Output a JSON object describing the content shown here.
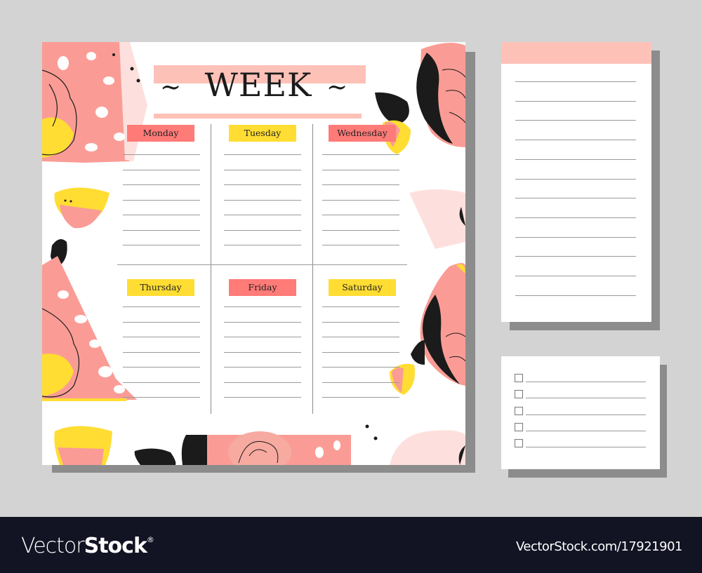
{
  "planner": {
    "title": "WEEK",
    "title_ornament_left": "~",
    "title_ornament_right": "~",
    "days": [
      {
        "label": "Monday",
        "color": "#ff7b78"
      },
      {
        "label": "Tuesday",
        "color": "#ffdd33"
      },
      {
        "label": "Wednesday",
        "color": "#ff7b78"
      },
      {
        "label": "Thursday",
        "color": "#ffdd33"
      },
      {
        "label": "Friday",
        "color": "#ff7b78"
      },
      {
        "label": "Saturday",
        "color": "#ffdd33"
      }
    ],
    "lines_per_day": 7
  },
  "notes": {
    "header_color": "#fdc1b8",
    "line_count": 12
  },
  "checklist": {
    "item_count": 5
  },
  "colors": {
    "background": "#d3d3d3",
    "paper": "#ffffff",
    "shadow": "#8c8c8c",
    "pink": "#fdc1b8",
    "coral": "#ff7b78",
    "salmon": "#fa9c95",
    "yellow": "#ffdd33",
    "black": "#1b1b1b",
    "footer_bg": "#121323"
  },
  "footer": {
    "brand_light": "Vector",
    "brand_bold": "Stock",
    "brand_mark": "®",
    "url": "VectorStock.com/17921901"
  }
}
